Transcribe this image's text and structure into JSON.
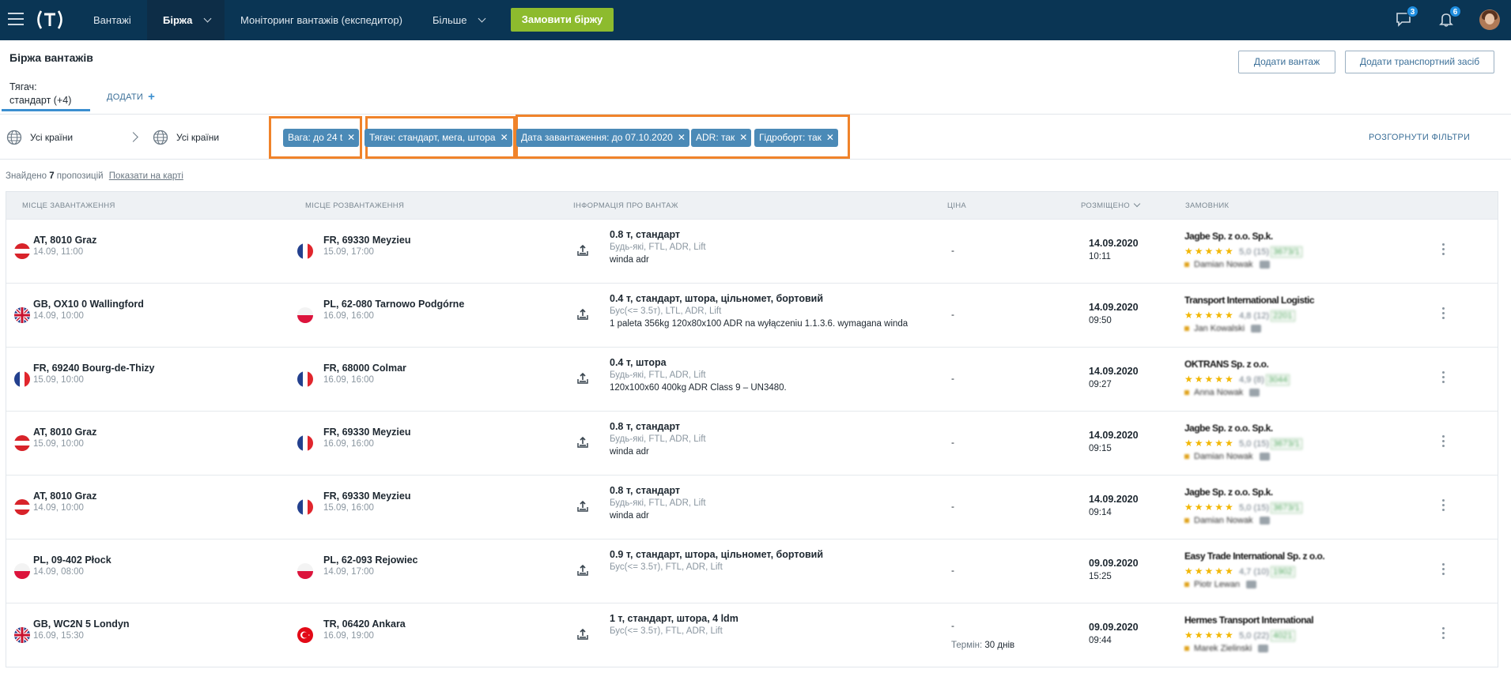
{
  "nav": {
    "items": [
      {
        "label": "Вантажі"
      },
      {
        "label": "Біржа"
      },
      {
        "label": "Моніторинг вантажів (експедитор)"
      },
      {
        "label": "Більше"
      }
    ],
    "order_button": "Замовити біржу",
    "messages_count": "3",
    "notifications_count": "6"
  },
  "page": {
    "title": "Біржа вантажів",
    "add_cargo_button": "Додати вантаж",
    "add_vehicle_button": "Додати транспортний засіб"
  },
  "tabs": {
    "active_label_line1": "Тягач:",
    "active_label_line2": "стандарт (+4)",
    "add_label": "ДОДАТИ"
  },
  "filters": {
    "from_country": "Усі країни",
    "to_country": "Усі країни",
    "chips": [
      {
        "label": "Вага: до 24 t"
      },
      {
        "label": "Тягач: стандарт, мега, штора"
      },
      {
        "label": "Дата завантаження: до 07.10.2020"
      },
      {
        "label": "ADR: так"
      },
      {
        "label": "Гідроборт: так"
      }
    ],
    "expand_label": "РОЗГОРНУТИ ФІЛЬТРИ"
  },
  "results": {
    "found_prefix": "Знайдено",
    "count": "7",
    "suffix": "пропозицій",
    "map_link": "Показати на карті"
  },
  "table": {
    "headers": {
      "loading": "МІСЦЕ ЗАВАНТАЖЕННЯ",
      "unloading": "МІСЦЕ РОЗВАНТАЖЕННЯ",
      "cargo": "ІНФОРМАЦІЯ ПРО ВАНТАЖ",
      "price": "ЦІНА",
      "posted": "РОЗМІЩЕНО",
      "customer": "ЗАМОВНИК"
    },
    "rows": [
      {
        "from_flag": "AT",
        "from": "AT, 8010 Graz",
        "from_date": "14.09, 11:00",
        "to_flag": "FR",
        "to": "FR, 69330 Meyzieu",
        "to_date": "15.09, 17:00",
        "cargo": "0.8 т, стандарт",
        "cargo_sub": "Будь-які, FTL, ADR, Lift",
        "cargo_note": "winda adr",
        "price": "-",
        "term_label": "",
        "term_value": "",
        "posted_date": "14.09.2020",
        "posted_time": "10:11",
        "customer": "Jagbe Sp. z o.o. Sp.k.",
        "rating": "5,0 (15)",
        "badge": "3673/1",
        "contact": "Damian Nowak"
      },
      {
        "from_flag": "GB",
        "from": "GB, OX10 0 Wallingford",
        "from_date": "14.09, 10:00",
        "to_flag": "PL",
        "to": "PL, 62-080 Tarnowo Podgórne",
        "to_date": "16.09, 16:00",
        "cargo": "0.4 т, стандарт, штора, цільномет, бортовий",
        "cargo_sub": "Бус(<= 3.5т), LTL, ADR, Lift",
        "cargo_note": "1 paleta 356kg 120x80x100 ADR na wyłączeniu 1.1.3.6. wymagana winda",
        "price": "-",
        "term_label": "",
        "term_value": "",
        "posted_date": "14.09.2020",
        "posted_time": "09:50",
        "customer": "Transport International Logistic",
        "rating": "4,8 (12)",
        "badge": "2201",
        "contact": "Jan Kowalski"
      },
      {
        "from_flag": "FR",
        "from": "FR, 69240 Bourg-de-Thizy",
        "from_date": "15.09, 10:00",
        "to_flag": "FR",
        "to": "FR, 68000 Colmar",
        "to_date": "16.09, 16:00",
        "cargo": "0.4 т, штора",
        "cargo_sub": "Будь-які, FTL, ADR, Lift",
        "cargo_note": "120x100x60 400kg ADR Class 9 – UN3480.",
        "price": "-",
        "term_label": "",
        "term_value": "",
        "posted_date": "14.09.2020",
        "posted_time": "09:27",
        "customer": "OKTRANS Sp. z o.o.",
        "rating": "4,9 (8)",
        "badge": "3044",
        "contact": "Anna Nowak"
      },
      {
        "from_flag": "AT",
        "from": "AT, 8010 Graz",
        "from_date": "15.09, 10:00",
        "to_flag": "FR",
        "to": "FR, 69330 Meyzieu",
        "to_date": "16.09, 16:00",
        "cargo": "0.8 т, стандарт",
        "cargo_sub": "Будь-які, FTL, ADR, Lift",
        "cargo_note": "winda adr",
        "price": "-",
        "term_label": "",
        "term_value": "",
        "posted_date": "14.09.2020",
        "posted_time": "09:15",
        "customer": "Jagbe Sp. z o.o. Sp.k.",
        "rating": "5,0 (15)",
        "badge": "3673/1",
        "contact": "Damian Nowak"
      },
      {
        "from_flag": "AT",
        "from": "AT, 8010 Graz",
        "from_date": "14.09, 10:00",
        "to_flag": "FR",
        "to": "FR, 69330 Meyzieu",
        "to_date": "15.09, 16:00",
        "cargo": "0.8 т, стандарт",
        "cargo_sub": "Будь-які, FTL, ADR, Lift",
        "cargo_note": "winda adr",
        "price": "-",
        "term_label": "",
        "term_value": "",
        "posted_date": "14.09.2020",
        "posted_time": "09:14",
        "customer": "Jagbe Sp. z o.o. Sp.k.",
        "rating": "5,0 (15)",
        "badge": "3673/1",
        "contact": "Damian Nowak"
      },
      {
        "from_flag": "PL",
        "from": "PL, 09-402 Płock",
        "from_date": "14.09, 08:00",
        "to_flag": "PL",
        "to": "PL, 62-093 Rejowiec",
        "to_date": "14.09, 17:00",
        "cargo": "0.9 т, стандарт, штора, цільномет, бортовий",
        "cargo_sub": "Бус(<= 3.5т), FTL, ADR, Lift",
        "cargo_note": "",
        "price": "-",
        "term_label": "",
        "term_value": "",
        "posted_date": "09.09.2020",
        "posted_time": "15:25",
        "customer": "Easy Trade International Sp. z o.o.",
        "rating": "4,7 (10)",
        "badge": "1902",
        "contact": "Piotr Lewan"
      },
      {
        "from_flag": "GB",
        "from": "GB, WC2N 5 Londyn",
        "from_date": "16.09, 15:30",
        "to_flag": "TR",
        "to": "TR, 06420 Ankara",
        "to_date": "16.09, 19:00",
        "cargo": "1 т, стандарт, штора, 4 ldm",
        "cargo_sub": "Бус(<= 3.5т), FTL, ADR, Lift",
        "cargo_note": "",
        "price": "-",
        "term_label": "Термін:",
        "term_value": "30 днів",
        "posted_date": "09.09.2020",
        "posted_time": "09:44",
        "customer": "Hermes Transport International",
        "rating": "5,0 (22)",
        "badge": "4021",
        "contact": "Marek Zielinski"
      }
    ]
  }
}
